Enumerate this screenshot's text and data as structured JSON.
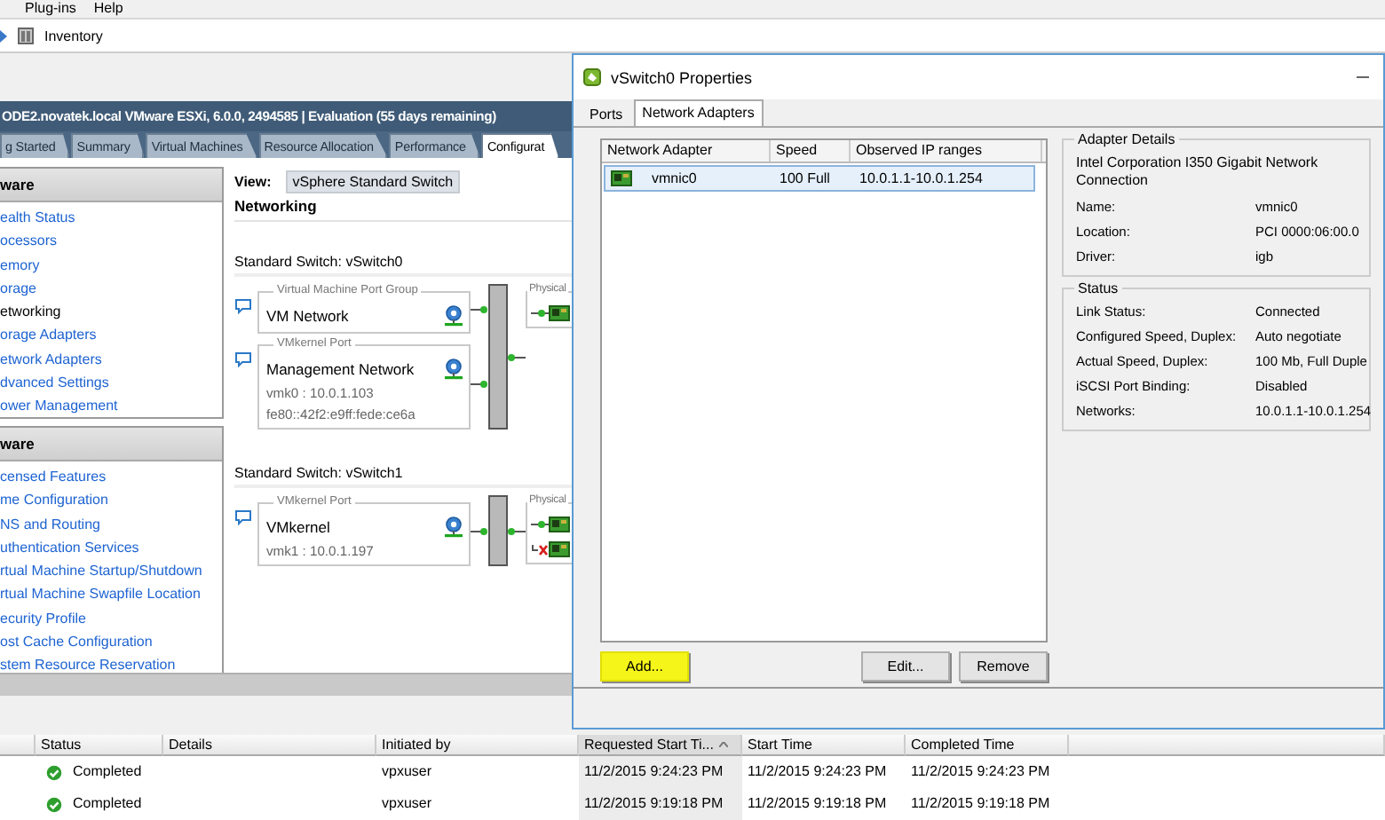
{
  "menu": [
    {
      "label": "Plug-ins"
    },
    {
      "label": "Help"
    }
  ],
  "nav": {
    "location": "Inventory"
  },
  "host": {
    "title": "ODE2.novatek.local VMware ESXi, 6.0.0, 2494585 | Evaluation (55 days remaining)",
    "tabs": [
      {
        "label": "g Started",
        "selected": false
      },
      {
        "label": "Summary",
        "selected": false
      },
      {
        "label": "Virtual Machines",
        "selected": false
      },
      {
        "label": "Resource Allocation",
        "selected": false
      },
      {
        "label": "Performance",
        "selected": false
      },
      {
        "label": "Configurat",
        "selected": true
      }
    ]
  },
  "sidebar": {
    "panels": [
      {
        "header": "ware",
        "items": [
          {
            "label": "ealth Status",
            "selected": false
          },
          {
            "label": "ocessors",
            "selected": false
          },
          {
            "label": "emory",
            "selected": false
          },
          {
            "label": "orage",
            "selected": false
          },
          {
            "label": "etworking",
            "selected": true
          },
          {
            "label": "orage Adapters",
            "selected": false
          },
          {
            "label": "etwork Adapters",
            "selected": false
          },
          {
            "label": "dvanced Settings",
            "selected": false
          },
          {
            "label": "ower Management",
            "selected": false
          }
        ]
      },
      {
        "header": "ware",
        "items": [
          {
            "label": "censed Features",
            "selected": false
          },
          {
            "label": "me Configuration",
            "selected": false
          },
          {
            "label": "NS and Routing",
            "selected": false
          },
          {
            "label": "uthentication Services",
            "selected": false
          },
          {
            "label": "rtual Machine Startup/Shutdown",
            "selected": false
          },
          {
            "label": "rtual Machine Swapfile Location",
            "selected": false
          },
          {
            "label": "ecurity Profile",
            "selected": false
          },
          {
            "label": "ost Cache Configuration",
            "selected": false
          },
          {
            "label": "stem Resource Reservation",
            "selected": false
          }
        ]
      }
    ]
  },
  "view": {
    "label": "View:",
    "value": "vSphere Standard Switch"
  },
  "section_title": "Networking",
  "switches": [
    {
      "title": "Standard Switch: vSwitch0",
      "physical_label": "Physical",
      "port_groups": [
        {
          "type": "Virtual Machine Port Group",
          "name": "VM Network"
        },
        {
          "type": "VMkernel Port",
          "name": "Management Network",
          "details": [
            "vmk0 : 10.0.1.103",
            "fe80::42f2:e9ff:fede:ce6a"
          ]
        }
      ],
      "uplinks": [
        {
          "connected": true
        }
      ]
    },
    {
      "title": "Standard Switch: vSwitch1",
      "physical_label": "Physical",
      "port_groups": [
        {
          "type": "VMkernel Port",
          "name": "VMkernel",
          "details": [
            "vmk1 : 10.0.1.197"
          ]
        }
      ],
      "uplinks": [
        {
          "connected": true
        },
        {
          "connected": false
        }
      ]
    }
  ],
  "tasks": {
    "columns": [
      {
        "label": "Status",
        "sorted": false
      },
      {
        "label": "Details",
        "sorted": false
      },
      {
        "label": "Initiated by",
        "sorted": false
      },
      {
        "label": "Requested Start Ti...",
        "sorted": true
      },
      {
        "label": "Start Time",
        "sorted": false
      },
      {
        "label": "Completed Time",
        "sorted": false
      }
    ],
    "rows": [
      {
        "status": "Completed",
        "kind": "success",
        "initiated_by": "vpxuser",
        "requested_start": "11/2/2015 9:24:23 PM",
        "start_time": "11/2/2015 9:24:23 PM",
        "completed_time": "11/2/2015 9:24:23 PM"
      },
      {
        "status": "Completed",
        "kind": "success",
        "initiated_by": "vpxuser",
        "requested_start": "11/2/2015 9:19:18 PM",
        "start_time": "11/2/2015 9:19:18 PM",
        "completed_time": "11/2/2015 9:19:18 PM"
      }
    ]
  },
  "dialog": {
    "title": "vSwitch0 Properties",
    "tabs": [
      {
        "label": "Ports",
        "selected": false
      },
      {
        "label": "Network Adapters",
        "selected": true
      }
    ],
    "adapters": {
      "columns": [
        "Network Adapter",
        "Speed",
        "Observed IP ranges"
      ],
      "rows": [
        {
          "name": "vmnic0",
          "speed": "100 Full",
          "ip_ranges": "10.0.1.1-10.0.1.254",
          "selected": true
        }
      ]
    },
    "adapter_details": {
      "title": "Adapter Details",
      "description": "Intel Corporation I350 Gigabit Network Connection",
      "fields": [
        {
          "label": "Name:",
          "value": "vmnic0"
        },
        {
          "label": "Location:",
          "value": "PCI 0000:06:00.0"
        },
        {
          "label": "Driver:",
          "value": "igb"
        }
      ]
    },
    "status": {
      "title": "Status",
      "fields": [
        {
          "label": "Link Status:",
          "value": "Connected"
        },
        {
          "label": "Configured Speed, Duplex:",
          "value": "Auto negotiate"
        },
        {
          "label": "Actual Speed, Duplex:",
          "value": "100 Mb, Full Duple"
        },
        {
          "label": "iSCSI Port Binding:",
          "value": "Disabled"
        },
        {
          "label": "Networks:",
          "value": "10.0.1.1-10.0.1.254"
        }
      ]
    },
    "buttons": [
      {
        "label": "Add...",
        "highlighted": true
      },
      {
        "label": "Edit...",
        "highlighted": false
      },
      {
        "label": "Remove",
        "highlighted": false
      }
    ]
  }
}
